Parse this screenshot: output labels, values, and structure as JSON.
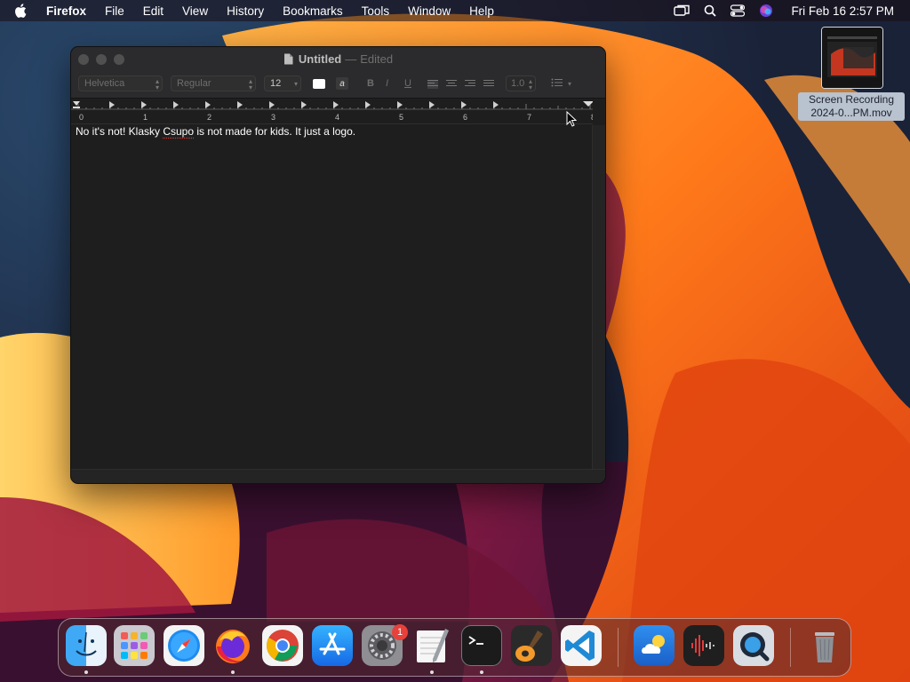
{
  "menubar": {
    "app_name": "Firefox",
    "items": [
      "File",
      "Edit",
      "View",
      "History",
      "Bookmarks",
      "Tools",
      "Window",
      "Help"
    ],
    "clock": "Fri Feb 16  2:57 PM",
    "icons": [
      "apple-icon",
      "screen-mirroring-icon",
      "spotlight-search-icon",
      "control-center-icon",
      "siri-icon"
    ]
  },
  "desktop_file": {
    "label_line1": "Screen Recording",
    "label_line2": "2024-0...PM.mov",
    "icon": "video-thumbnail-icon"
  },
  "window": {
    "title": "Untitled",
    "separator": "—",
    "status": "Edited",
    "toolbar": {
      "font_family": "Helvetica",
      "font_style": "Regular",
      "font_size": "12",
      "bold": "B",
      "italic": "I",
      "underline": "U",
      "highlight": "a",
      "line_spacing": "1.0",
      "text_color": "#ffffff"
    },
    "ruler_numbers": [
      "0",
      "1",
      "2",
      "3",
      "4",
      "5",
      "6",
      "7",
      "8"
    ],
    "document": {
      "text_before": "No it's not! Klasky ",
      "misspelled_word": "Csupo",
      "text_after": " is not made for kids. It just a logo."
    }
  },
  "dock": {
    "apps": [
      "Finder",
      "Launchpad",
      "Safari",
      "Firefox",
      "Chrome",
      "App Store",
      "System Settings",
      "TextEdit",
      "Terminal",
      "GarageBand",
      "Visual Studio Code",
      "Weather",
      "Voice Memos",
      "QuickTime Player",
      "Trash"
    ],
    "system_settings_badge": "1"
  },
  "colors": {
    "menu_text": "#ffffff",
    "window_bg": "#1e1e1e",
    "badge": "#e8403a"
  }
}
